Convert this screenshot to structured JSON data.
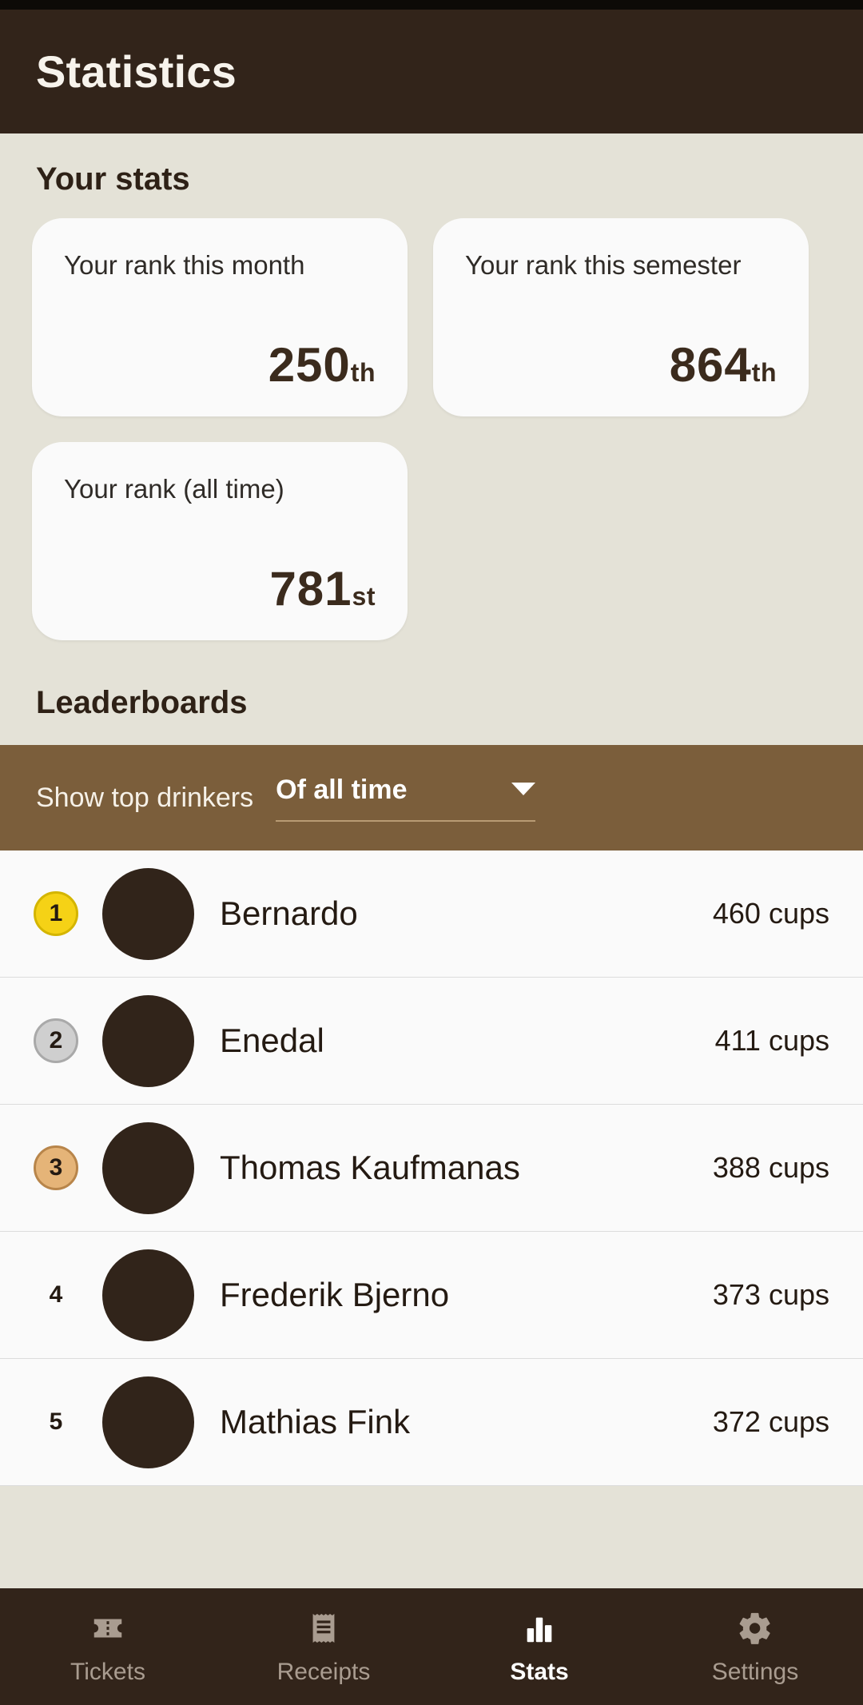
{
  "app": {
    "title": "Statistics"
  },
  "colors": {
    "app_bar": "#32241a",
    "background": "#e4e2d7",
    "card": "#fafafa",
    "filter_bar": "#7b5e3b",
    "accent_gold": "#f5d216",
    "accent_silver": "#cfcfcf",
    "accent_bronze": "#e5b478",
    "avatar": "#31241a",
    "text_dark": "#241a12"
  },
  "your_stats": {
    "heading": "Your stats",
    "cards": [
      {
        "label": "Your rank this month",
        "number": "250",
        "suffix": "th"
      },
      {
        "label": "Your rank this semester",
        "number": "864",
        "suffix": "th"
      },
      {
        "label": "Your rank (all time)",
        "number": "781",
        "suffix": "st"
      }
    ]
  },
  "leaderboards": {
    "heading": "Leaderboards",
    "filter": {
      "label": "Show top drinkers",
      "selected": "Of all time",
      "caret_icon": "chevron-down-icon",
      "options": [
        "Of all time"
      ]
    },
    "rows": [
      {
        "rank": "1",
        "medal": "gold",
        "name": "Bernardo",
        "count": "460 cups",
        "avatar_icon": "avatar-circle"
      },
      {
        "rank": "2",
        "medal": "silver",
        "name": "Enedal",
        "count": "411 cups",
        "avatar_icon": "avatar-circle"
      },
      {
        "rank": "3",
        "medal": "bronze",
        "name": "Thomas Kaufmanas",
        "count": "388 cups",
        "avatar_icon": "avatar-circle"
      },
      {
        "rank": "4",
        "medal": "none",
        "name": "Frederik Bjerno",
        "count": "373 cups",
        "avatar_icon": "avatar-circle"
      },
      {
        "rank": "5",
        "medal": "none",
        "name": "Mathias Fink",
        "count": "372 cups",
        "avatar_icon": "avatar-circle"
      }
    ]
  },
  "bottom_nav": {
    "items": [
      {
        "label": "Tickets",
        "icon": "ticket-icon",
        "active": false
      },
      {
        "label": "Receipts",
        "icon": "receipt-icon",
        "active": false
      },
      {
        "label": "Stats",
        "icon": "bar-chart-icon",
        "active": true
      },
      {
        "label": "Settings",
        "icon": "gear-icon",
        "active": false
      }
    ]
  }
}
